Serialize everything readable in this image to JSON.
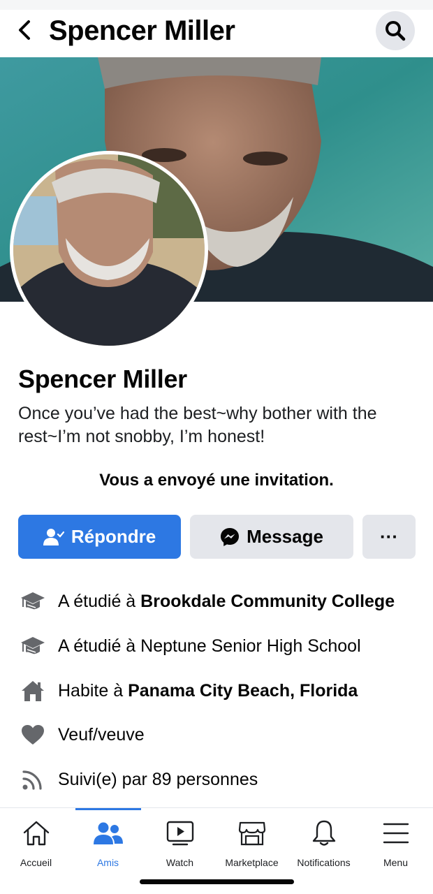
{
  "header": {
    "title": "Spencer Miller",
    "back_icon": "chevron-left-icon",
    "search_icon": "search-icon"
  },
  "profile": {
    "name": "Spencer Miller",
    "bio": "Once you’ve had the best~why bother with the rest~I’m not snobby, I’m honest!",
    "invite_text": "Vous a envoyé une invitation."
  },
  "actions": {
    "respond_label": "Répondre",
    "message_label": "Message",
    "more_label": "···"
  },
  "info": [
    {
      "icon": "graduation-cap-icon",
      "prefix": "A étudié à ",
      "bold": "Brookdale Community College",
      "plain": ""
    },
    {
      "icon": "graduation-cap-icon",
      "prefix": "A étudié à Neptune Senior High School",
      "bold": "",
      "plain": ""
    },
    {
      "icon": "house-icon",
      "prefix": "Habite à ",
      "bold": "Panama City Beach, Florida",
      "plain": ""
    },
    {
      "icon": "heart-icon",
      "prefix": "Veuf/veuve",
      "bold": "",
      "plain": ""
    },
    {
      "icon": "rss-feed-icon",
      "prefix": "Suivi(e) par 89 personnes",
      "bold": "",
      "plain": ""
    }
  ],
  "tabs": [
    {
      "label": "Accueil",
      "icon": "home-icon",
      "active": false
    },
    {
      "label": "Amis",
      "icon": "friends-icon",
      "active": true
    },
    {
      "label": "Watch",
      "icon": "watch-icon",
      "active": false
    },
    {
      "label": "Marketplace",
      "icon": "marketplace-icon",
      "active": false
    },
    {
      "label": "Notifications",
      "icon": "bell-icon",
      "active": false
    },
    {
      "label": "Menu",
      "icon": "menu-icon",
      "active": false
    }
  ],
  "colors": {
    "accent": "#2d78e3",
    "button_gray": "#e4e6eb",
    "text": "#050505"
  }
}
